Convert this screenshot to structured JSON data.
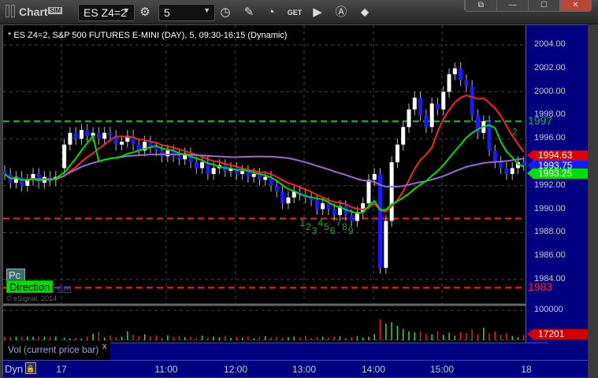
{
  "toolbar": {
    "app_title": "Chart",
    "sim_badge": "SIM",
    "symbol": "ES Z4=2",
    "interval": "5",
    "icons": [
      "settings-gear-icon",
      "clock-icon",
      "pencil-icon",
      "study-icon",
      "get-icon",
      "play-icon",
      "alert-icon",
      "link-icon"
    ],
    "window_buttons": [
      "restore-menu",
      "minimize",
      "maximize",
      "close"
    ]
  },
  "chart": {
    "title": "* ES Z4=2, S&P 500 FUTURES E-MINI (DAY), 5, 09:30-16:15 (Dynamic)",
    "price_ticks": [
      "2004.00",
      "2002.00",
      "2000.00",
      "1998.00",
      "1996.00",
      "1994.00",
      "1992.00",
      "1990.00",
      "1988.00",
      "1986.00",
      "1984.00"
    ],
    "price_tags": [
      {
        "label": "1994.63",
        "color": "#e00000"
      },
      {
        "label": "1993.75",
        "color": "#1a1aff"
      },
      {
        "label": "1993.25",
        "color": "#00dd00"
      }
    ],
    "levels": [
      {
        "label": "1997",
        "value": 1997.5,
        "color": "#00cc00"
      },
      {
        "label": "1983",
        "value": 1983.3,
        "color": "#ff2020"
      },
      {
        "label": "",
        "value": 1989.2,
        "color": "#ff2020"
      }
    ],
    "pc_label": "Pc",
    "direction_label": "Direction",
    "link_text": "om",
    "copyright": "© eSignal, 2014",
    "sequence_labels": [
      "1",
      "2",
      "3",
      "4",
      "5",
      "6",
      "7",
      "8",
      "9"
    ],
    "sequence_top_label": "2",
    "colors": {
      "up": "#ffffff",
      "down": "#1a1aff",
      "ma_fast": "#ff2020",
      "ma_slow": "#9a6ad0",
      "direction": "#00dd00"
    }
  },
  "volume": {
    "label": "Vol (current price bar)",
    "close_label": "x",
    "ticks": [
      "100000"
    ],
    "current": "17201"
  },
  "time_axis": {
    "mode": "Dyn",
    "labels": [
      "17",
      "11:00",
      "12:00",
      "13:00",
      "14:00",
      "15:00",
      "18"
    ]
  },
  "chart_data": {
    "type": "candlestick",
    "ylim": [
      1982.5,
      2005
    ],
    "prior_closes": [
      1993,
      1992.25,
      1992.75,
      1992,
      1992.5,
      1993,
      1992.25,
      1992.75,
      1992.5,
      1992.75
    ],
    "closes": [
      1995.5,
      1996.5,
      1996,
      1996.75,
      1996.25,
      1996.5,
      1996,
      1996.5,
      1996.25,
      1995.5,
      1995.75,
      1996.25,
      1995.5,
      1995,
      1995.75,
      1995.25,
      1995,
      1994.5,
      1995,
      1994.5,
      1994.25,
      1994.75,
      1994,
      1993.5,
      1994,
      1993,
      1993.5,
      1993.75,
      1993.25,
      1993.5,
      1993,
      1993.25,
      1992.75,
      1993,
      1992.5,
      1992.75,
      1992,
      1991.5,
      1990.5,
      1991,
      1991.5,
      1991.25,
      1991,
      1990.75,
      1990,
      1990.5,
      1990,
      1989.5,
      1990.25,
      1989.5,
      1989,
      1989.75,
      1990.5,
      1992.5,
      1993,
      1985,
      1989,
      1994,
      1995.5,
      1997,
      1998.5,
      1999.5,
      1998,
      1997,
      1999,
      1998.5,
      2000,
      2001.5,
      2002,
      2001,
      2000.5,
      1998,
      1996.5,
      1997.5,
      1995,
      1994,
      1993.5,
      1993,
      1993.5,
      1994,
      1993.75
    ],
    "volumes": [
      9000,
      7000,
      8000,
      6000,
      12000,
      22000,
      28000,
      9000,
      15000,
      10000,
      12000,
      30000,
      18000,
      14000,
      20000,
      12000,
      15000,
      9000,
      16000,
      11000,
      14000,
      10000,
      12000,
      8000,
      15000,
      9000,
      12000,
      10000,
      14000,
      8000,
      11000,
      9000,
      12000,
      7000,
      10000,
      13000,
      9000,
      11000,
      8000,
      10000,
      12000,
      9000,
      14000,
      8000,
      10000,
      12000,
      9000,
      11000,
      13000,
      8000,
      10000,
      14000,
      9000,
      12000,
      20000,
      70000,
      55000,
      60000,
      48000,
      38000,
      30000,
      26000,
      30000,
      22000,
      20000,
      30000,
      18000,
      25000,
      15000,
      28000,
      24000,
      35000,
      20000,
      42000,
      22000,
      30000,
      18000,
      24000,
      14000,
      10000,
      17201
    ]
  }
}
